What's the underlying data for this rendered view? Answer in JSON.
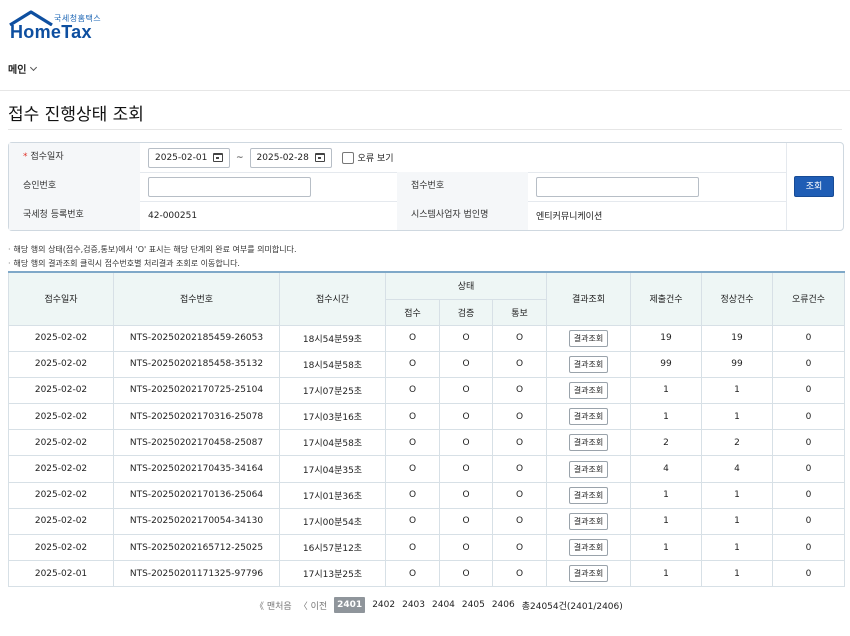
{
  "logo": {
    "sub": "국세청홈택스",
    "main": "HomeTax"
  },
  "menu": {
    "label": "메인"
  },
  "page": {
    "title": "접수 진행상태 조회"
  },
  "search": {
    "date_label": "접수일자",
    "date_from": "2025-02-01",
    "date_to": "2025-02-28",
    "tilde": "~",
    "error_view_label": "오류 보기",
    "approval_label": "승인번호",
    "approval_value": "",
    "receipt_no_label": "접수번호",
    "receipt_no_value": "",
    "reg_no_label": "국세청 등록번호",
    "reg_no_value": "42-000251",
    "corp_name_label": "시스템사업자 법인명",
    "corp_name_value": "엔티커뮤니케이션",
    "button_label": "조회"
  },
  "notes": [
    "해당 행의 상태(접수,검증,통보)에서 'O' 표시는 해당 단계의 완료 여부를 의미합니다.",
    "해당 행의 결과조회 클릭시 접수번호별 처리결과 조회로 이동합니다."
  ],
  "table": {
    "headers": {
      "date": "접수일자",
      "receipt_no": "접수번호",
      "time": "접수시간",
      "status": "상태",
      "status_receive": "접수",
      "status_verify": "검증",
      "status_notify": "통보",
      "result": "결과조회",
      "submitted": "제출건수",
      "normal": "정상건수",
      "error": "오류건수"
    },
    "result_button": "결과조회",
    "rows": [
      {
        "date": "2025-02-02",
        "no": "NTS-20250202185459-26053",
        "time": "18시54분59초",
        "s1": "O",
        "s2": "O",
        "s3": "O",
        "submitted": "19",
        "normal": "19",
        "error": "0"
      },
      {
        "date": "2025-02-02",
        "no": "NTS-20250202185458-35132",
        "time": "18시54분58초",
        "s1": "O",
        "s2": "O",
        "s3": "O",
        "submitted": "99",
        "normal": "99",
        "error": "0"
      },
      {
        "date": "2025-02-02",
        "no": "NTS-20250202170725-25104",
        "time": "17시07분25초",
        "s1": "O",
        "s2": "O",
        "s3": "O",
        "submitted": "1",
        "normal": "1",
        "error": "0"
      },
      {
        "date": "2025-02-02",
        "no": "NTS-20250202170316-25078",
        "time": "17시03분16초",
        "s1": "O",
        "s2": "O",
        "s3": "O",
        "submitted": "1",
        "normal": "1",
        "error": "0"
      },
      {
        "date": "2025-02-02",
        "no": "NTS-20250202170458-25087",
        "time": "17시04분58초",
        "s1": "O",
        "s2": "O",
        "s3": "O",
        "submitted": "2",
        "normal": "2",
        "error": "0"
      },
      {
        "date": "2025-02-02",
        "no": "NTS-20250202170435-34164",
        "time": "17시04분35초",
        "s1": "O",
        "s2": "O",
        "s3": "O",
        "submitted": "4",
        "normal": "4",
        "error": "0"
      },
      {
        "date": "2025-02-02",
        "no": "NTS-20250202170136-25064",
        "time": "17시01분36초",
        "s1": "O",
        "s2": "O",
        "s3": "O",
        "submitted": "1",
        "normal": "1",
        "error": "0"
      },
      {
        "date": "2025-02-02",
        "no": "NTS-20250202170054-34130",
        "time": "17시00분54초",
        "s1": "O",
        "s2": "O",
        "s3": "O",
        "submitted": "1",
        "normal": "1",
        "error": "0"
      },
      {
        "date": "2025-02-02",
        "no": "NTS-20250202165712-25025",
        "time": "16시57분12초",
        "s1": "O",
        "s2": "O",
        "s3": "O",
        "submitted": "1",
        "normal": "1",
        "error": "0"
      },
      {
        "date": "2025-02-01",
        "no": "NTS-20250201171325-97796",
        "time": "17시13분25초",
        "s1": "O",
        "s2": "O",
        "s3": "O",
        "submitted": "1",
        "normal": "1",
        "error": "0"
      }
    ]
  },
  "pager": {
    "first": "《 맨처음",
    "prev": "〈 이전",
    "pages": [
      "2401",
      "2402",
      "2403",
      "2404",
      "2405",
      "2406"
    ],
    "current": "2401",
    "summary": "총24054건(2401/2406)"
  }
}
